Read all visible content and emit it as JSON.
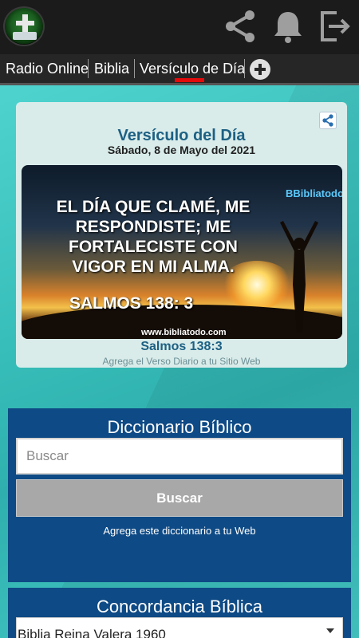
{
  "appbar": {
    "icons": [
      "logo-icon",
      "share-icon",
      "bell-icon",
      "exit-icon"
    ]
  },
  "tabs": [
    {
      "label": "Radio Online"
    },
    {
      "label": "Biblia"
    },
    {
      "label": "Versículo de Día"
    }
  ],
  "verse_card": {
    "title": "Versículo del Día",
    "date": "Sábado, 8 de Mayo del 2021",
    "image_text": "EL DÍA QUE CLAMÉ, ME RESPONDISTE; ME FORTALECISTE CON VIGOR EN MI ALMA.",
    "image_reference": "SALMOS 138: 3",
    "image_url": "www.bibliatodo.com",
    "image_brand": "Bibliatodo",
    "reference": "Salmos 138:3",
    "add_link": "Agrega el Verso Diario a tu Sitio Web"
  },
  "dictionary": {
    "title": "Diccionario Bíblico",
    "placeholder": "Buscar",
    "button_label": "Buscar",
    "add_link": "Agrega este diccionario a tu Web"
  },
  "concordance": {
    "title": "Concordancia Bíblica",
    "selected_version": "Biblia Reina Valera 1960"
  },
  "colors": {
    "appbar": "#1b1b1b",
    "tab_indicator": "#e30b0b",
    "panel_blue": "#0e4a85",
    "title_blue": "#1d6083",
    "background_teal": "#3fc6c4"
  }
}
